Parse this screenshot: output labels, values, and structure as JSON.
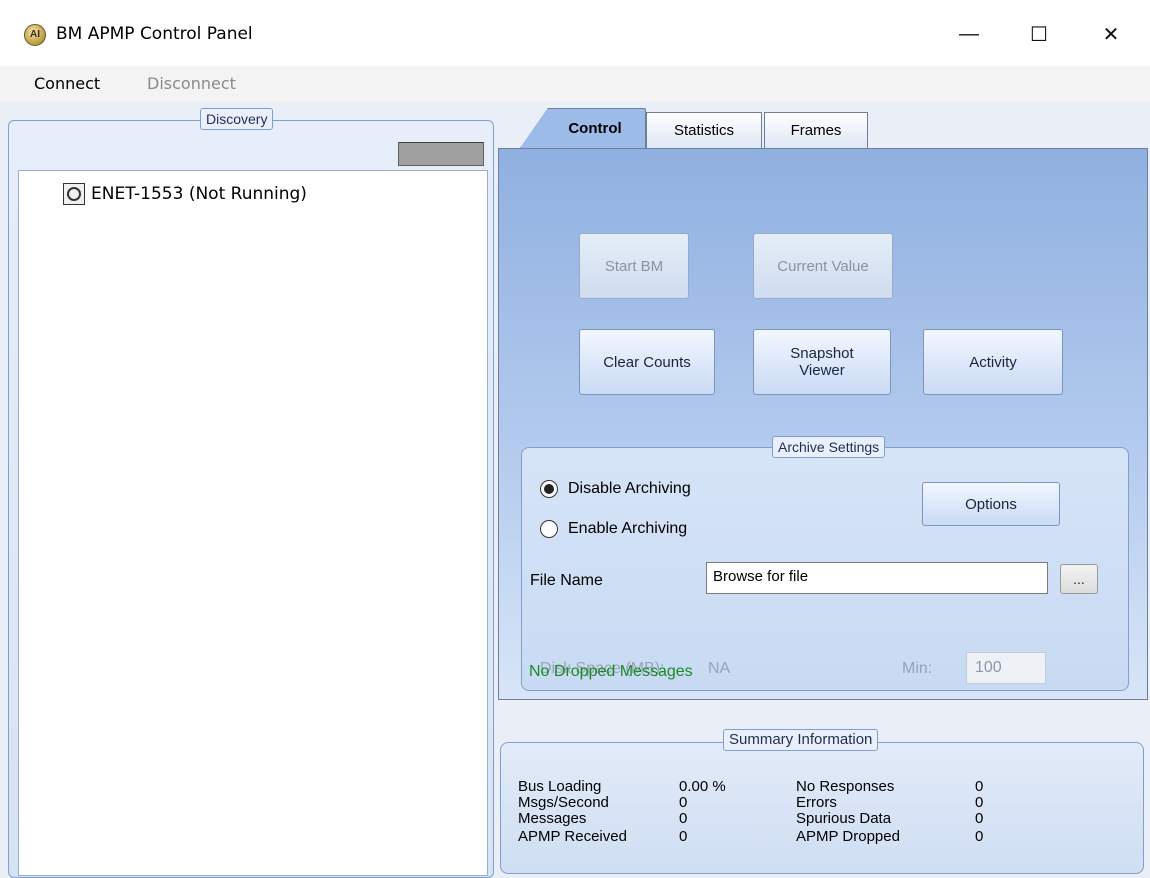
{
  "window": {
    "title": "BM APMP Control Panel",
    "icon_text": "AI",
    "min_glyph": "—",
    "max_glyph": "☐",
    "close_glyph": "✕"
  },
  "menu": {
    "connect": "Connect",
    "disconnect": "Disconnect"
  },
  "discovery": {
    "title": "Discovery",
    "tree": [
      {
        "label": "ENET-1553 (Not Running)"
      }
    ]
  },
  "tabs": [
    {
      "label": "Control",
      "active": true
    },
    {
      "label": "Statistics",
      "active": false
    },
    {
      "label": "Frames",
      "active": false
    }
  ],
  "control": {
    "start_bm": "Start BM",
    "current_value": "Current Value",
    "clear_counts": "Clear Counts",
    "snapshot_viewer_line1": "Snapshot",
    "snapshot_viewer_line2": "Viewer",
    "activity": "Activity",
    "archive": {
      "title": "Archive Settings",
      "disable_label": "Disable Archiving",
      "enable_label": "Enable Archiving",
      "selected": "disable",
      "options_label": "Options",
      "file_name_label": "File Name",
      "file_name_value": "Browse for file",
      "browse_label": "...",
      "disk_space_label": "Disk Space (MB):",
      "disk_space_value": "NA",
      "min_label": "Min:",
      "min_value": "100"
    },
    "dropped_status": "No Dropped Messages"
  },
  "summary": {
    "title": "Summary Information",
    "left": [
      {
        "label": "Bus Loading",
        "value": "0.00 %"
      },
      {
        "label": "Msgs/Second",
        "value": "0"
      },
      {
        "label": "Messages",
        "value": "0"
      },
      {
        "label": "APMP Received",
        "value": "0"
      }
    ],
    "right": [
      {
        "label": "No Responses",
        "value": "0"
      },
      {
        "label": "Errors",
        "value": "0"
      },
      {
        "label": "Spurious Data",
        "value": "0"
      },
      {
        "label": "APMP Dropped",
        "value": "0"
      }
    ]
  },
  "colors": {
    "status_ok": "#1a8a25",
    "panel_blue": "#8fb0e0"
  }
}
